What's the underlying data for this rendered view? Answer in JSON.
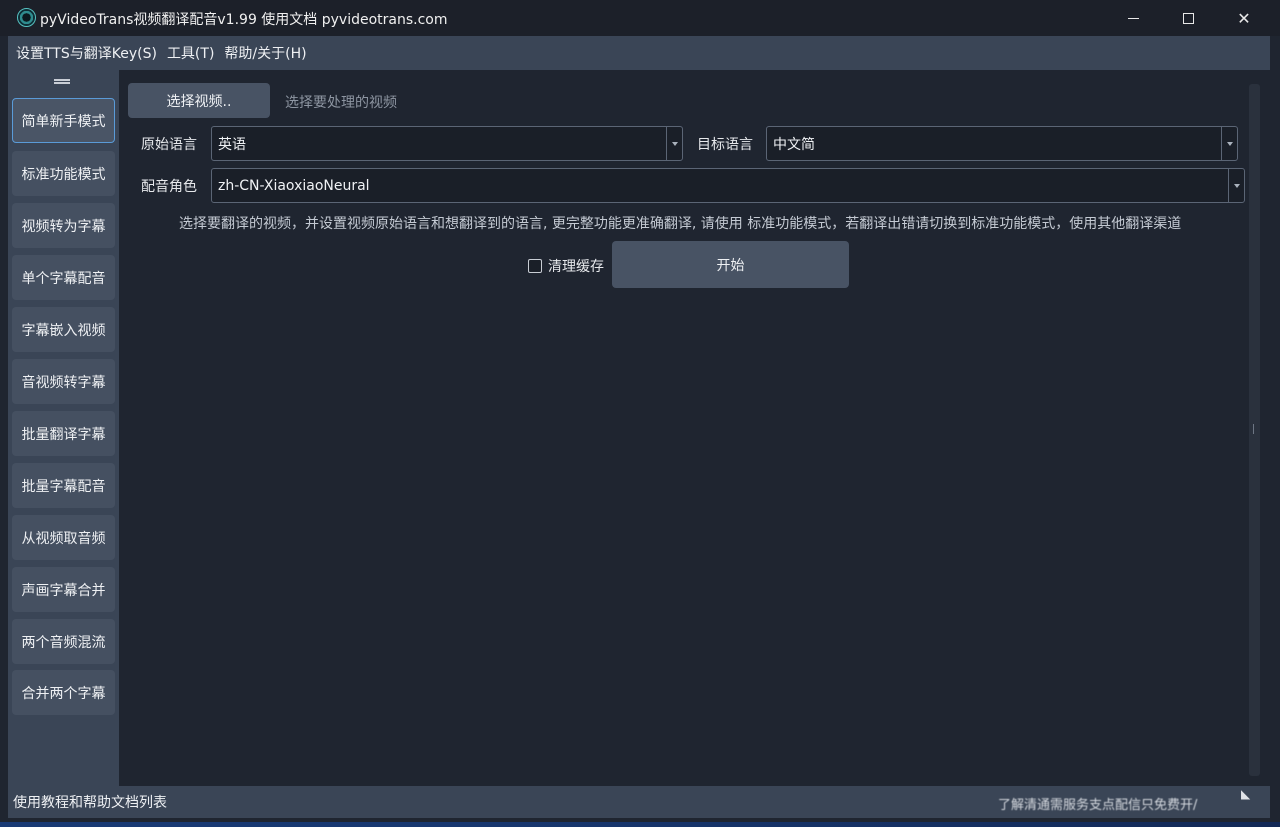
{
  "window": {
    "title": "pyVideoTrans视频翻译配音v1.99  使用文档  pyvideotrans.com"
  },
  "menubar": {
    "items": [
      {
        "label": "设置TTS与翻译Key(S)"
      },
      {
        "label": "工具(T)"
      },
      {
        "label": "帮助/关于(H)"
      }
    ]
  },
  "sidebar": {
    "items": [
      {
        "label": "简单新手模式",
        "active": true
      },
      {
        "label": "标准功能模式"
      },
      {
        "label": "视频转为字幕"
      },
      {
        "label": "单个字幕配音"
      },
      {
        "label": "字幕嵌入视频"
      },
      {
        "label": "音视频转字幕"
      },
      {
        "label": "批量翻译字幕"
      },
      {
        "label": "批量字幕配音"
      },
      {
        "label": "从视频取音频"
      },
      {
        "label": "声画字幕合并"
      },
      {
        "label": "两个音频混流"
      },
      {
        "label": "合并两个字幕"
      }
    ]
  },
  "main": {
    "pick_video_label": "选择视频..",
    "pick_video_hint": "选择要处理的视频",
    "source_language_label": "原始语言",
    "source_language_value": "英语",
    "target_language_label": "目标语言",
    "target_language_value": "中文简",
    "voice_role_label": "配音角色",
    "voice_role_value": "zh-CN-XiaoxiaoNeural",
    "info_text": "选择要翻译的视频，并设置视频原始语言和想翻译到的语言, 更完整功能更准确翻译, 请使用 标准功能模式，若翻译出错请切换到标准功能模式，使用其他翻译渠道",
    "clear_cache_label": "清理缓存",
    "clear_cache_checked": false,
    "start_label": "开始"
  },
  "statusbar": {
    "left_text": "使用教程和帮助文档列表",
    "right_text_line2": "了解清通需服务支点配信只免费开/"
  },
  "colors": {
    "background": "#1f2530",
    "panel": "#3a4556",
    "button": "#485364",
    "accent_border": "#5a9bd8"
  }
}
